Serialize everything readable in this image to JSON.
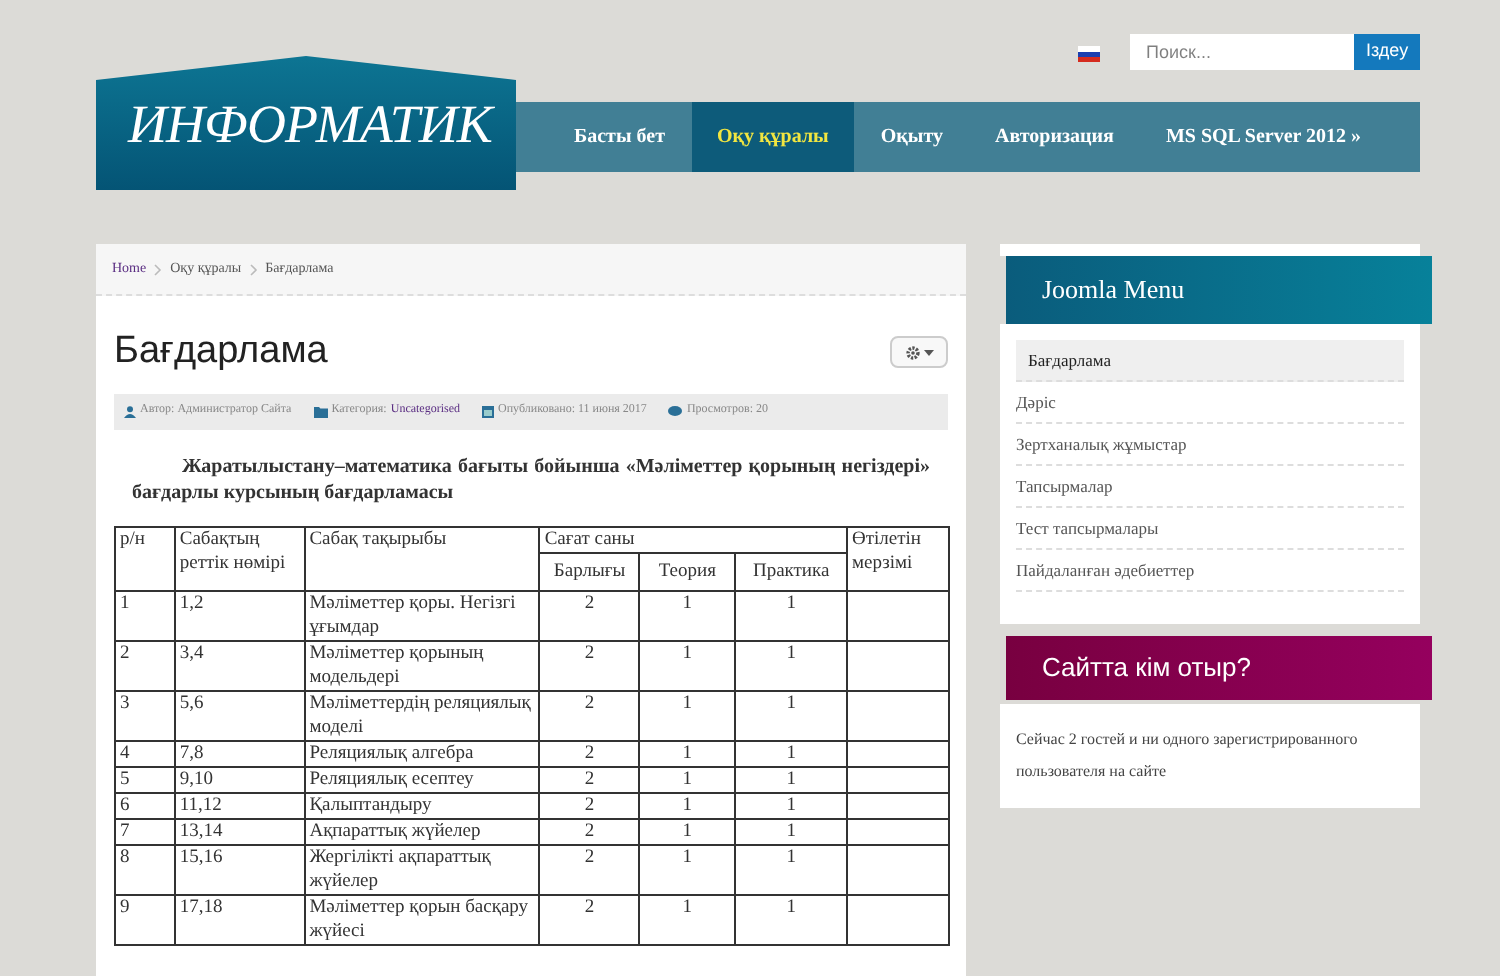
{
  "header": {
    "logo": "ИНФОРМАТИК",
    "search": {
      "placeholder": "Поиск...",
      "button": "Іздеу"
    },
    "nav": [
      {
        "label": "Басты бет",
        "selected": false
      },
      {
        "label": "Оқу құралы",
        "selected": true
      },
      {
        "label": "Оқыту",
        "selected": false
      },
      {
        "label": "Авторизация",
        "selected": false
      },
      {
        "label": "MS SQL Server 2012 »",
        "selected": false
      }
    ]
  },
  "breadcrumb": [
    "Home",
    "Оқу құралы",
    "Бағдарлама"
  ],
  "article": {
    "title": "Бағдарлама",
    "meta": [
      {
        "kind": "author",
        "text": "Автор: Администратор Сайта"
      },
      {
        "kind": "category",
        "text": "Категория: ",
        "link": "Uncategorised"
      },
      {
        "kind": "date",
        "text": "Опубликовано: 11 июня 2017"
      },
      {
        "kind": "views",
        "text": "Просмотров: 20"
      }
    ],
    "intro": "Жаратылыстану–математика бағыты бойынша «Мәліметтер қорының негіздері» бағдарлы  курсының бағдарламасы",
    "table": {
      "header_rows": [
        [
          {
            "text": "р/н",
            "rowspan": 2
          },
          {
            "text": "Сабақтың реттік нөмірі",
            "rowspan": 2
          },
          {
            "text": "Сабақ тақырыбы",
            "rowspan": 2
          },
          {
            "text": "Сағат саны",
            "colspan": 3
          },
          {
            "text": "Өтілетін мерзімі",
            "rowspan": 2
          }
        ],
        [
          {
            "text": "Барлығы"
          },
          {
            "text": "Теория"
          },
          {
            "text": "Практика"
          }
        ]
      ],
      "rows": [
        [
          "1",
          "1,2",
          "Мәліметтер қоры. Негізгі ұғымдар",
          "2",
          "1",
          "1"
        ],
        [
          "2",
          "3,4",
          "Мәліметтер қорының модельдері",
          "2",
          "1",
          "1"
        ],
        [
          "3",
          "5,6",
          "Мәліметтердің реляциялық моделі",
          "2",
          "1",
          "1"
        ],
        [
          "4",
          "7,8",
          "Реляциялық алгебра",
          "2",
          "1",
          "1"
        ],
        [
          "5",
          "9,10",
          "Реляциялық есептеу",
          "2",
          "1",
          "1"
        ],
        [
          "6",
          "11,12",
          "Қалыптандыру",
          "2",
          "1",
          "1"
        ],
        [
          "7",
          "13,14",
          "Ақпараттық жүйелер",
          "2",
          "1",
          "1"
        ],
        [
          "8",
          "15,16",
          "Жергілікті ақпараттық жүйелер",
          "2",
          "1",
          "1"
        ],
        [
          "9",
          "17,18",
          "Мәліметтер қорын басқару жүйесі",
          "2",
          "1",
          "1"
        ]
      ]
    }
  },
  "sidebar": {
    "menu": {
      "title": "Joomla Menu",
      "items": [
        {
          "label": "Бағдарлама",
          "selected": true
        },
        {
          "label": "Дәріс",
          "selected": false
        },
        {
          "label": "Зертханалық жұмыстар",
          "selected": false
        },
        {
          "label": "Тапсырмалар",
          "selected": false
        },
        {
          "label": "Тест тапсырмалары",
          "selected": false
        },
        {
          "label": "Пайдаланған әдебиеттер",
          "selected": false
        }
      ]
    },
    "online": {
      "title": "Сайтта кім отыр?",
      "text": "Сейчас 2 гостей и ни одного зарегистрированного пользователя на сайте"
    }
  }
}
